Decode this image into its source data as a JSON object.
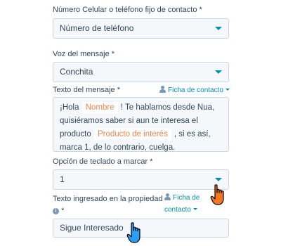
{
  "phone_field": {
    "label": "Número Celular o teléfono fijo de contacto *",
    "value": "Número de teléfono"
  },
  "voice_field": {
    "label": "Voz del mensaje *",
    "value": "Conchita"
  },
  "message_field": {
    "label": "Texto del mensaje *",
    "contact_link": "Ficha de contacto",
    "line1_pre": "¡Hola",
    "token_name": "Nombre",
    "line1_post": "! Te hablamos desde Nua,",
    "line2": "quisiéramos saber si aun te interesa el",
    "line3_pre": "producto",
    "token_product": "Producto de interés",
    "line3_post": ", si es así,",
    "line4": "marca 1, de lo contrario, cuelga."
  },
  "keypad_field": {
    "label": "Opción de teclado a marcar *",
    "value": "1"
  },
  "property_field": {
    "label_line1": "Texto ingresado en la propiedad",
    "label_line2": "*",
    "info_icon_glyph": "i",
    "contact_link_line1": "Ficha de",
    "contact_link_line2": "contacto",
    "value": "Sigue Interesado"
  },
  "colors": {
    "accent": "#0091ae",
    "token_text": "#f2854f",
    "cursor_fill": "#f57722",
    "cursor_fill_blue": "#2a9df4"
  },
  "icons": {
    "contact_icon": "person-icon",
    "dropdown_icon": "chevron-down-icon",
    "cursor_orange": "hand-pointer-icon",
    "cursor_blue": "hand-pointer-icon",
    "info": "info-icon"
  }
}
